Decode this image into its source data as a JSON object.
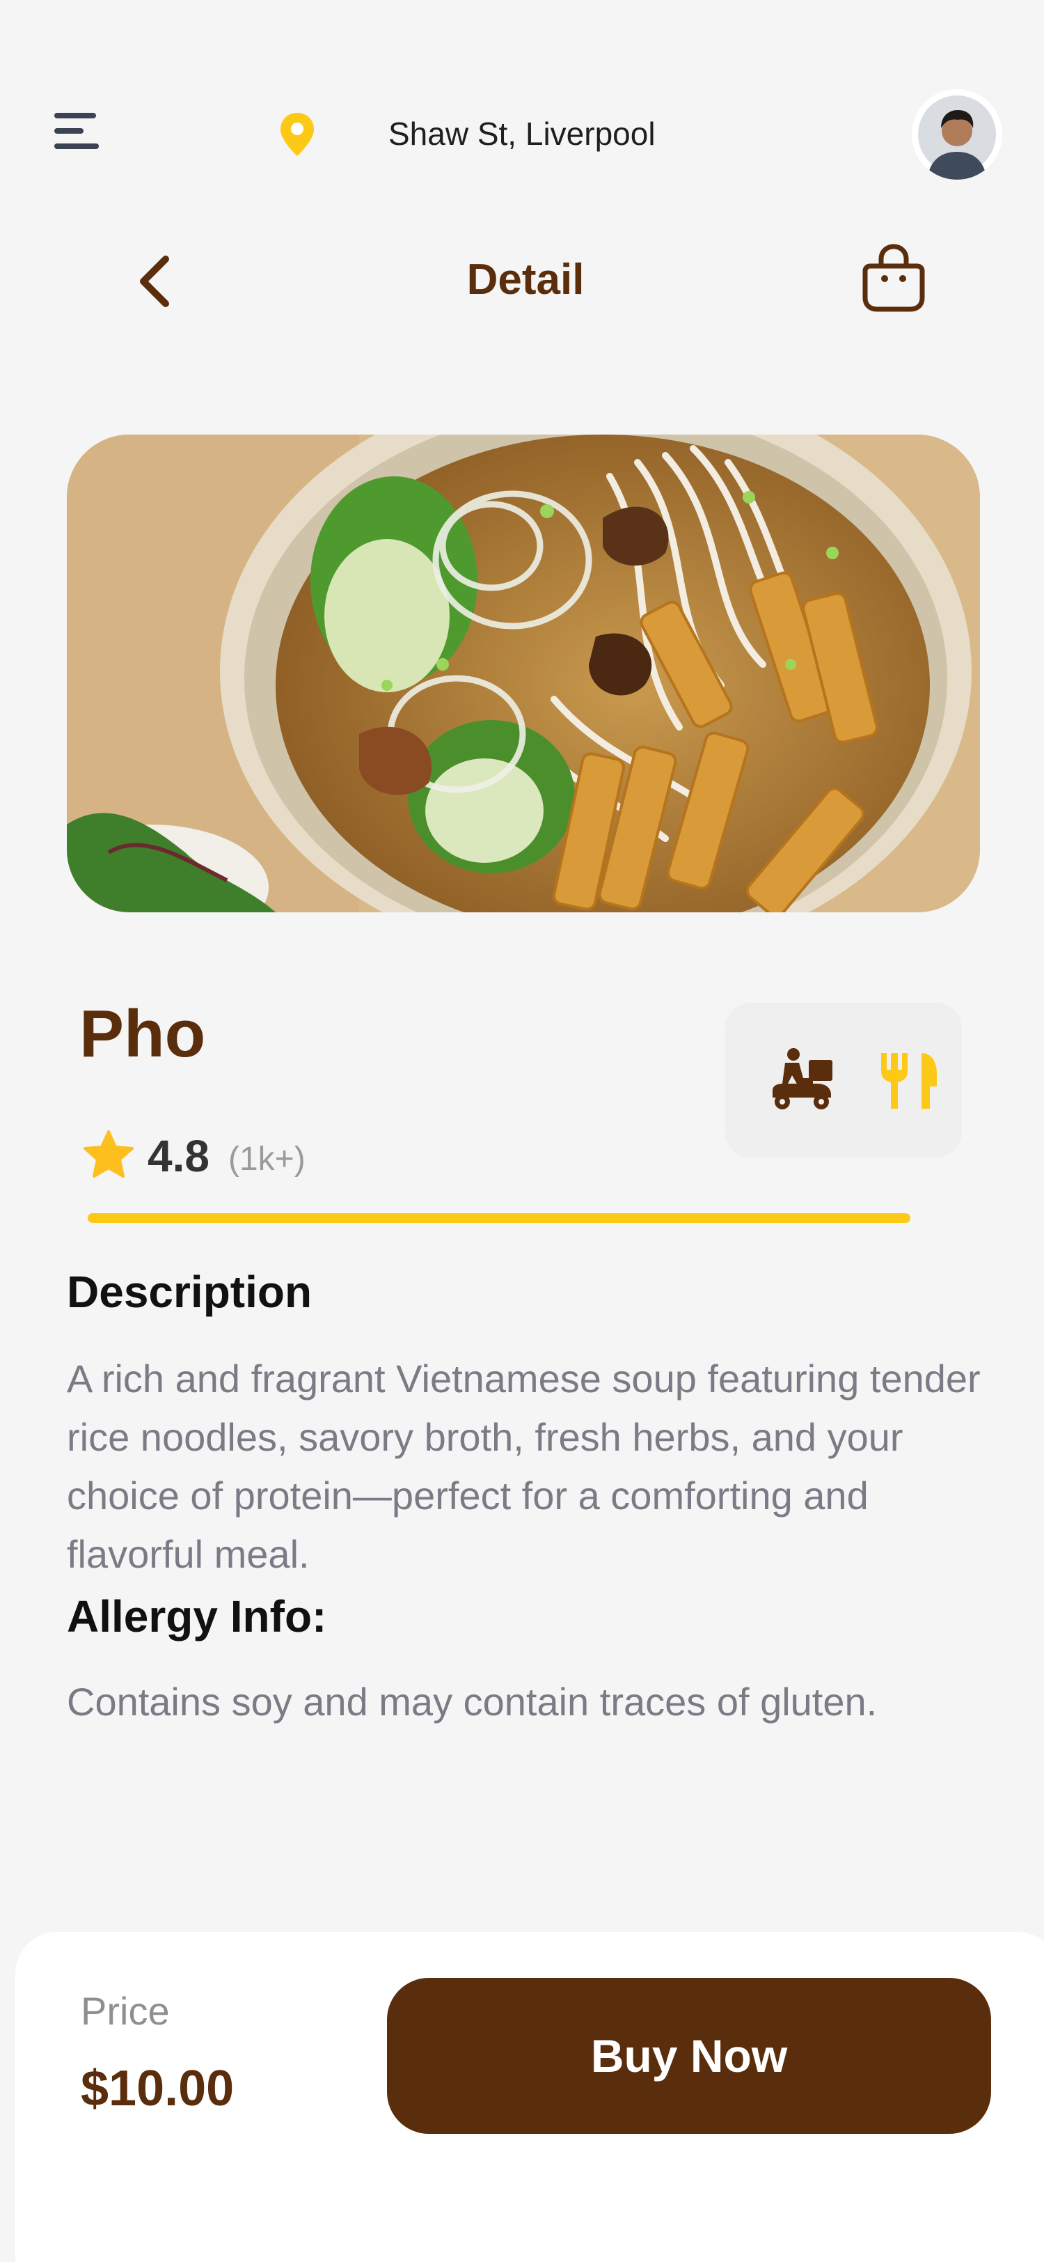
{
  "header": {
    "location": "Shaw St, Liverpool",
    "icons": {
      "menu": "menu-icon",
      "location": "map-pin-icon",
      "avatar": "user-avatar"
    }
  },
  "nav": {
    "title": "Detail",
    "icons": {
      "back": "chevron-left-icon",
      "cart": "shopping-bag-icon"
    }
  },
  "product": {
    "name": "Pho",
    "rating": "4.8",
    "rating_count": "(1k+)",
    "image": "pho-bowl-photo",
    "services": [
      "delivery-scooter-icon",
      "dine-in-utensils-icon"
    ]
  },
  "description": {
    "title": "Description",
    "text": "A rich and fragrant Vietnamese soup featuring tender rice noodles, savory broth, fresh herbs, and your choice of protein—perfect for a comforting and flavorful meal."
  },
  "allergy": {
    "title": "Allergy Info:",
    "text": "Contains soy and may contain traces of gluten."
  },
  "footer": {
    "price_label": "Price",
    "price_value": "$10.00",
    "buy_label": "Buy Now"
  },
  "colors": {
    "brown": "#5a2d0c",
    "yellow": "#fcca16",
    "background": "#f5f5f5",
    "muted_text": "#7b7b86"
  }
}
